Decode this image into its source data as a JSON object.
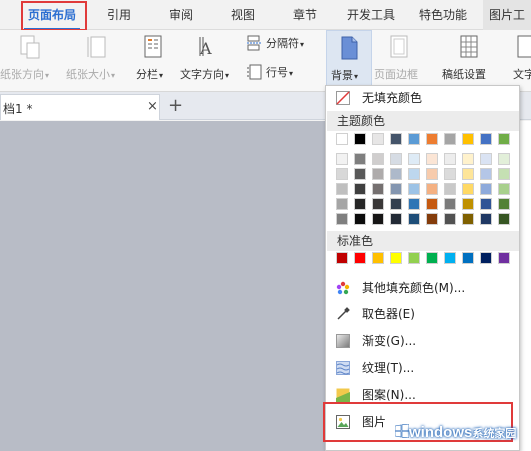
{
  "menu": {
    "tabs": [
      "页面布局",
      "引用",
      "审阅",
      "视图",
      "章节",
      "开发工具",
      "特色功能",
      "图片工"
    ],
    "active": "页面布局"
  },
  "ribbon": {
    "paper_orientation": "纸张方向",
    "paper_size": "纸张大小",
    "columns": "分栏",
    "text_direction": "文字方向",
    "separator": "分隔符",
    "line_number": "行号",
    "background": "背景",
    "page_border": "页面边框",
    "manuscript": "稿纸设置",
    "text_cut": "文字"
  },
  "document_tab": {
    "title": "档1 *",
    "close": "×",
    "add": "+"
  },
  "dropdown": {
    "no_fill": "无填充颜色",
    "theme_colors_label": "主题颜色",
    "standard_colors_label": "标准色",
    "more_colors": "其他填充颜色(M)...",
    "eyedropper": "取色器(E)",
    "gradient": "渐变(G)...",
    "texture": "纹理(T)...",
    "pattern": "图案(N)...",
    "picture": "图片",
    "theme_top_row": [
      "#ffffff",
      "#000000",
      "#e7e6e6",
      "#44546a",
      "#5b9bd5",
      "#ed7d31",
      "#a5a5a5",
      "#ffc000",
      "#4472c4",
      "#70ad47"
    ],
    "theme_shades": [
      [
        "#f2f2f2",
        "#7f7f7f",
        "#d0cece",
        "#d6dce4",
        "#deebf6",
        "#fbe5d5",
        "#ededed",
        "#fff2cc",
        "#dae3f3",
        "#e2efd9"
      ],
      [
        "#d8d8d8",
        "#595959",
        "#aeabab",
        "#adb9ca",
        "#bdd7ee",
        "#f7cbac",
        "#dbdbdb",
        "#fee599",
        "#b4c6e7",
        "#c5e0b3"
      ],
      [
        "#bfbfbf",
        "#3f3f3f",
        "#757070",
        "#8496b0",
        "#9dc3e6",
        "#f4b183",
        "#c9c9c9",
        "#ffd965",
        "#8eaadb",
        "#a8d08d"
      ],
      [
        "#a5a5a5",
        "#262626",
        "#3a3838",
        "#323f4f",
        "#2e75b5",
        "#c55a11",
        "#7b7b7b",
        "#bf9000",
        "#2f5496",
        "#538135"
      ],
      [
        "#7f7f7f",
        "#0c0c0c",
        "#171616",
        "#222a35",
        "#1e4e79",
        "#843c0b",
        "#525252",
        "#7f6000",
        "#1f3864",
        "#375623"
      ]
    ],
    "standard_colors": [
      "#c00000",
      "#ff0000",
      "#ffc000",
      "#ffff00",
      "#92d050",
      "#00b050",
      "#00b0f0",
      "#0070c0",
      "#002060",
      "#7030a0"
    ]
  },
  "watermark": {
    "brand": "windows",
    "suffix": "系统家园"
  }
}
